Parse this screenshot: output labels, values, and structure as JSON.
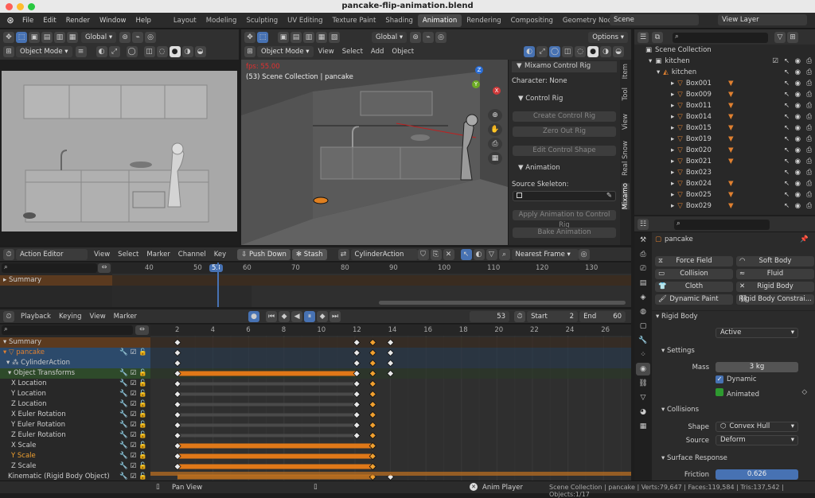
{
  "window": {
    "title": "pancake-flip-animation.blend"
  },
  "menu": [
    "File",
    "Edit",
    "Render",
    "Window",
    "Help"
  ],
  "workspaces": [
    "Layout",
    "Modeling",
    "Sculpting",
    "UV Editing",
    "Texture Paint",
    "Shading",
    "Animation",
    "Rendering",
    "Compositing",
    "Geometry Nodes"
  ],
  "active_workspace": "Animation",
  "scene": {
    "label": "Scene",
    "view_layer": "View Layer"
  },
  "left_viewport": {
    "orientation": "Global",
    "mode": "Object Mode"
  },
  "main_viewport": {
    "orientation": "Global",
    "mode": "Object Mode",
    "menu": [
      "View",
      "Select",
      "Add",
      "Object"
    ],
    "options": "Options",
    "fps": "fps: 55.00",
    "info": "(53) Scene Collection | pancake",
    "gizmo_axes": {
      "z": "Z",
      "y": "Y",
      "x": "X"
    }
  },
  "mixamo": {
    "panel_title": "Mixamo Control Rig",
    "character": "Character: None",
    "control_rig_section": "Control Rig",
    "create_btn": "Create Control Rig",
    "zero_btn": "Zero Out Rig",
    "edit_shape_btn": "Edit Control Shape",
    "animation_section": "Animation",
    "source_skeleton": "Source Skeleton:",
    "apply_btn": "Apply Animation to Control Rig",
    "bake_btn": "Bake Animation",
    "tabs": [
      "Item",
      "Tool",
      "View",
      "Real Snow",
      "Mixamo"
    ]
  },
  "action_editor": {
    "mode": "Action Editor",
    "menu": [
      "View",
      "Select",
      "Marker",
      "Channel",
      "Key"
    ],
    "push_down": "Push Down",
    "stash": "Stash",
    "action_name": "CylinderAction",
    "snap": "Nearest Frame",
    "summary": "Summary",
    "ticks": [
      "40",
      "50",
      "53",
      "60",
      "70",
      "80",
      "90",
      "100",
      "110",
      "120",
      "130"
    ],
    "current_frame": "53"
  },
  "timeline": {
    "menu": [
      "Playback",
      "Keying",
      "View",
      "Marker"
    ],
    "frame": "53",
    "start_label": "Start",
    "start": "2",
    "end_label": "End",
    "end": "60",
    "ticks": [
      "2",
      "4",
      "6",
      "8",
      "10",
      "12",
      "14",
      "16",
      "18",
      "20",
      "22",
      "24",
      "26"
    ],
    "channels": [
      {
        "name": "Summary",
        "kind": "summary"
      },
      {
        "name": "pancake",
        "kind": "object"
      },
      {
        "name": "CylinderAction",
        "kind": "action"
      },
      {
        "name": "Object Transforms",
        "kind": "group"
      },
      {
        "name": "X Location",
        "kind": "fcurve"
      },
      {
        "name": "Y Location",
        "kind": "fcurve"
      },
      {
        "name": "Z Location",
        "kind": "fcurve"
      },
      {
        "name": "X Euler Rotation",
        "kind": "fcurve"
      },
      {
        "name": "Y Euler Rotation",
        "kind": "fcurve"
      },
      {
        "name": "Z Euler Rotation",
        "kind": "fcurve"
      },
      {
        "name": "X Scale",
        "kind": "fcurve"
      },
      {
        "name": "Y Scale",
        "kind": "fcurve-selected"
      },
      {
        "name": "Z Scale",
        "kind": "fcurve"
      },
      {
        "name": "Kinematic (Rigid Body Object)",
        "kind": "fcurve"
      }
    ]
  },
  "outliner": {
    "root": "Scene Collection",
    "collection": "kitchen",
    "object": "kitchen",
    "items": [
      "Box001",
      "Box009",
      "Box011",
      "Box014",
      "Box015",
      "Box019",
      "Box020",
      "Box021",
      "Box023",
      "Box024",
      "Box025",
      "Box029"
    ]
  },
  "properties": {
    "object_name": "pancake",
    "physics_buttons": [
      "Force Field",
      "Soft Body",
      "Collision",
      "Fluid",
      "Cloth",
      "Rigid Body",
      "Dynamic Paint",
      "Rigid Body Constrai..."
    ],
    "rigid_body": "Rigid Body",
    "type_label": "Type",
    "type_value": "Active",
    "settings": "Settings",
    "mass_label": "Mass",
    "mass_value": "3 kg",
    "dynamic": "Dynamic",
    "animated": "Animated",
    "collisions": "Collisions",
    "shape_label": "Shape",
    "shape_value": "Convex Hull",
    "source_label": "Source",
    "source_value": "Deform",
    "surface_response": "Surface Response",
    "friction_label": "Friction",
    "friction_value": "0.626"
  },
  "statusbar": {
    "pan": "Pan View",
    "anim_player": "Anim Player",
    "stats": "Scene Collection | pancake | Verts:79,647 | Faces:119,584 | Tris:137,542 | Objects:1/17"
  },
  "colors": {
    "accent": "#4772b3",
    "keyframe_bar": "#e07818",
    "selected_key": "#f0a030",
    "fps_red": "#e03030"
  }
}
